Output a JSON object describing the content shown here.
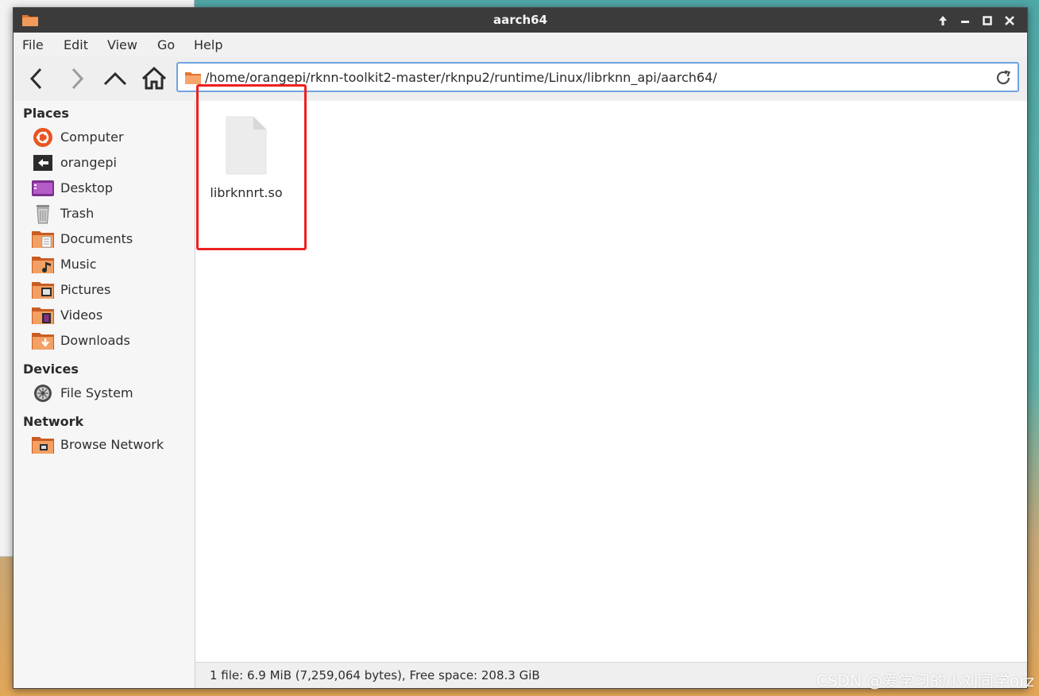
{
  "window": {
    "title": "aarch64",
    "controls": [
      "maximize-up",
      "minimize",
      "restore",
      "close"
    ]
  },
  "menu": {
    "file": "File",
    "edit": "Edit",
    "view": "View",
    "go": "Go",
    "help": "Help"
  },
  "toolbar": {
    "back_icon": "chevron-left-icon",
    "forward_icon": "chevron-right-icon",
    "up_icon": "chevron-up-icon",
    "home_icon": "home-icon"
  },
  "location": {
    "path": "/home/orangepi/rknn-toolkit2-master/rknpu2/runtime/Linux/librknn_api/aarch64/"
  },
  "sidebar": {
    "places_header": "Places",
    "places": [
      {
        "label": "Computer",
        "icon": "ubuntu-logo-icon"
      },
      {
        "label": "orangepi",
        "icon": "user-home-icon"
      },
      {
        "label": "Desktop",
        "icon": "desktop-icon"
      },
      {
        "label": "Trash",
        "icon": "trash-icon"
      },
      {
        "label": "Documents",
        "icon": "documents-folder-icon"
      },
      {
        "label": "Music",
        "icon": "music-folder-icon"
      },
      {
        "label": "Pictures",
        "icon": "pictures-folder-icon"
      },
      {
        "label": "Videos",
        "icon": "videos-folder-icon"
      },
      {
        "label": "Downloads",
        "icon": "downloads-folder-icon"
      }
    ],
    "devices_header": "Devices",
    "devices": [
      {
        "label": "File System",
        "icon": "harddisk-icon"
      }
    ],
    "network_header": "Network",
    "network": [
      {
        "label": "Browse Network",
        "icon": "network-folder-icon"
      }
    ]
  },
  "files": [
    {
      "name": "librknnrt.so",
      "icon": "generic-file-icon"
    }
  ],
  "status": {
    "text": "1 file: 6.9 MiB (7,259,064 bytes), Free space: 208.3 GiB"
  },
  "watermark": "CSDN @爱学习的小刘同学orz",
  "colors": {
    "titlebar": "#3b3b3b",
    "accent_border": "#6fa3e0",
    "highlight": "#ee2020",
    "folder_orange": "#e6732e"
  }
}
